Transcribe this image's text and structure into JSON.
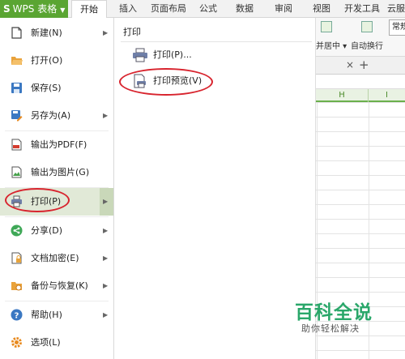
{
  "app": {
    "button_label": "WPS 表格",
    "logo_glyph": "S"
  },
  "ribbon_tabs": [
    "开始",
    "插入",
    "页面布局",
    "公式",
    "数据",
    "审阅",
    "视图",
    "开发工具",
    "云服"
  ],
  "toolbar": {
    "merge_center": "并居中",
    "wrap_text": "自动换行",
    "style_box": "常规"
  },
  "grid": {
    "columns": [
      "H",
      "I"
    ]
  },
  "file_menu": {
    "items": [
      {
        "label": "新建(N)",
        "icon": "new-file-icon",
        "has_arrow": true
      },
      {
        "label": "打开(O)",
        "icon": "folder-open-icon",
        "has_arrow": false
      },
      {
        "label": "保存(S)",
        "icon": "save-icon",
        "has_arrow": false
      },
      {
        "label": "另存为(A)",
        "icon": "save-as-icon",
        "has_arrow": true
      },
      {
        "label": "输出为PDF(F)",
        "icon": "pdf-icon",
        "has_arrow": false
      },
      {
        "label": "输出为图片(G)",
        "icon": "image-export-icon",
        "has_arrow": false
      },
      {
        "label": "打印(P)",
        "icon": "printer-icon",
        "has_arrow": true
      },
      {
        "label": "分享(D)",
        "icon": "share-icon",
        "has_arrow": true
      },
      {
        "label": "文档加密(E)",
        "icon": "encrypt-icon",
        "has_arrow": true
      },
      {
        "label": "备份与恢复(K)",
        "icon": "backup-icon",
        "has_arrow": true
      },
      {
        "label": "帮助(H)",
        "icon": "help-icon",
        "has_arrow": true
      },
      {
        "label": "选项(L)",
        "icon": "options-gear-icon",
        "has_arrow": false
      }
    ],
    "active_index": 6
  },
  "print_submenu": {
    "title": "打印",
    "items": [
      {
        "label": "打印(P)...",
        "icon": "printer-icon"
      },
      {
        "label": "打印预览(V)",
        "icon": "print-preview-icon"
      }
    ]
  },
  "watermark": {
    "title": "百科全说",
    "subtitle": "助你轻松解决"
  },
  "colors": {
    "accent_green": "#5aa532",
    "highlight_bg": "#e1e9d7",
    "annotation_red": "#d8242e",
    "watermark_green": "#2aa76a"
  }
}
